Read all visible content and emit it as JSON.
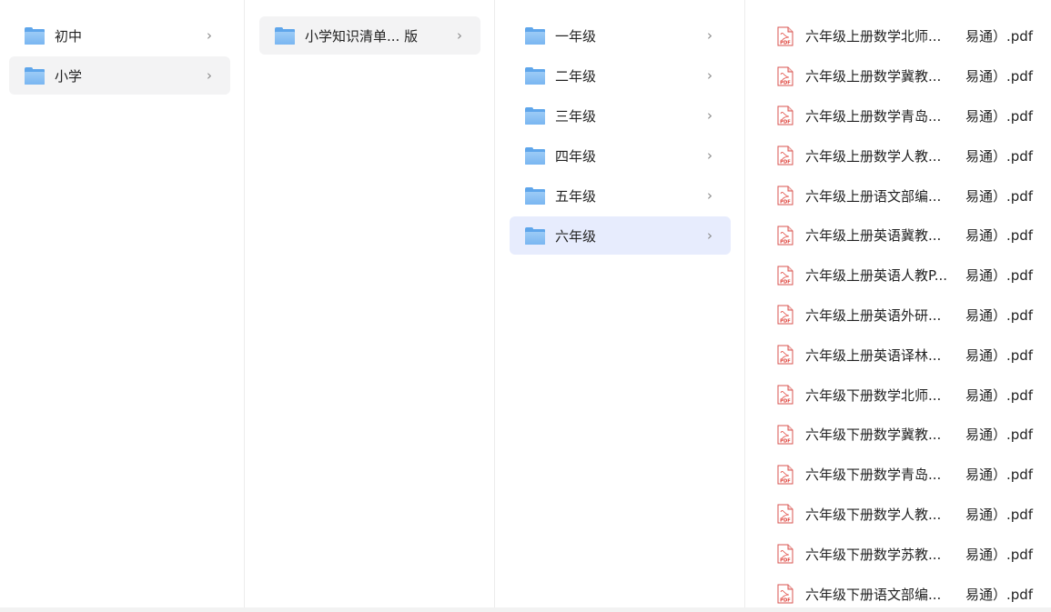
{
  "column1": {
    "items": [
      {
        "label": "初中",
        "chevron": "›"
      },
      {
        "label": "小学",
        "chevron": "›"
      }
    ]
  },
  "column2": {
    "items": [
      {
        "label": "小学知识清单... 版",
        "chevron": "›"
      }
    ]
  },
  "column3": {
    "items": [
      {
        "label": "一年级",
        "chevron": "›"
      },
      {
        "label": "二年级",
        "chevron": "›"
      },
      {
        "label": "三年级",
        "chevron": "›"
      },
      {
        "label": "四年级",
        "chevron": "›"
      },
      {
        "label": "五年级",
        "chevron": "›"
      },
      {
        "label": "六年级",
        "chevron": "›"
      }
    ]
  },
  "column4": {
    "files": [
      {
        "name": "六年级上册数学北师...",
        "suffix": "易通）.pdf"
      },
      {
        "name": "六年级上册数学冀教...",
        "suffix": "易通）.pdf"
      },
      {
        "name": "六年级上册数学青岛...",
        "suffix": "易通）.pdf"
      },
      {
        "name": "六年级上册数学人教...",
        "suffix": "易通）.pdf"
      },
      {
        "name": "六年级上册语文部编...",
        "suffix": "易通）.pdf"
      },
      {
        "name": "六年级上册英语冀教...",
        "suffix": "易通）.pdf"
      },
      {
        "name": "六年级上册英语人教P...",
        "suffix": "易通）.pdf"
      },
      {
        "name": "六年级上册英语外研...",
        "suffix": "易通）.pdf"
      },
      {
        "name": "六年级上册英语译林...",
        "suffix": "易通）.pdf"
      },
      {
        "name": "六年级下册数学北师...",
        "suffix": "易通）.pdf"
      },
      {
        "name": "六年级下册数学冀教...",
        "suffix": "易通）.pdf"
      },
      {
        "name": "六年级下册数学青岛...",
        "suffix": "易通）.pdf"
      },
      {
        "name": "六年级下册数学人教...",
        "suffix": "易通）.pdf"
      },
      {
        "name": "六年级下册数学苏教...",
        "suffix": "易通）.pdf"
      },
      {
        "name": "六年级下册语文部编...",
        "suffix": "易通）.pdf"
      }
    ],
    "icon_label": "PDF"
  },
  "colors": {
    "folder_back": "#5fa6eb",
    "folder_front": "#88bff4",
    "selected_gray": "#f3f3f4",
    "selected_blue": "#e7ecfd",
    "pdf_red": "#e0453d"
  },
  "icons": {
    "folder": "folder-icon",
    "pdf": "pdf-file-icon",
    "chevron": "chevron-right-icon"
  }
}
